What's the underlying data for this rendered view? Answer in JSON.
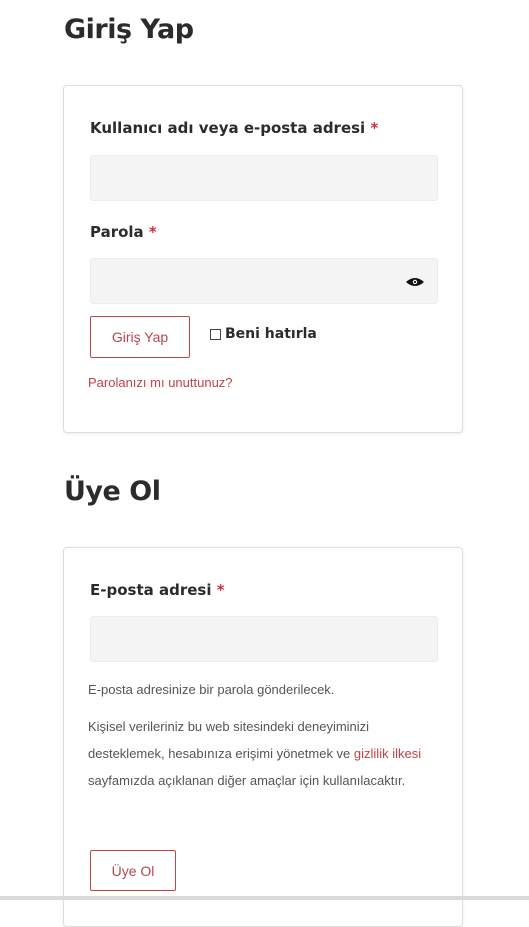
{
  "login": {
    "title": "Giriş Yap",
    "username_label": "Kullanıcı adı veya e-posta adresi",
    "required_marker": "*",
    "password_label": "Parola",
    "username_value": "",
    "password_value": "",
    "show_password_icon": "eye-icon",
    "submit_label": "Giriş Yap",
    "remember_label": "Beni hatırla",
    "remember_checked": false,
    "lost_password_link": "Parolanızı mı unuttunuz?"
  },
  "register": {
    "title": "Üye Ol",
    "email_label": "E-posta adresi",
    "required_marker": "*",
    "email_value": "",
    "password_note": "E-posta adresinize bir parola gönderilecek.",
    "privacy_text_before": "Kişisel verileriniz bu web sitesindeki deneyiminizi desteklemek, hesabınıza erişimi yönetmek ve ",
    "privacy_link": "gizlilik ilkesi",
    "privacy_text_after": " sayfamızda açıklanan diğer amaçlar için kullanılacaktır.",
    "submit_label": "Üye Ol"
  },
  "colors": {
    "accent": "#c0424a",
    "required": "#d0303a",
    "input_bg": "#f4f4f4",
    "border": "#dedede"
  }
}
